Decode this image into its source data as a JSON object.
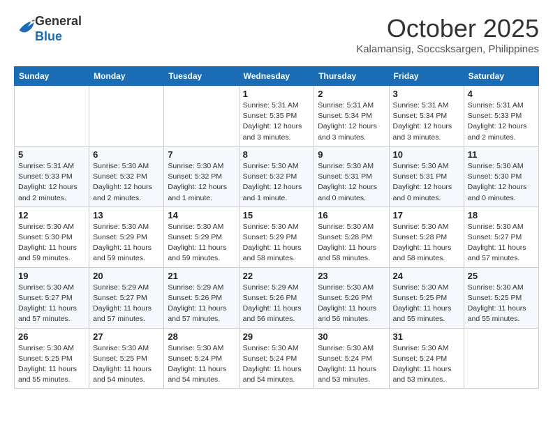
{
  "logo": {
    "general": "General",
    "blue": "Blue"
  },
  "title": "October 2025",
  "subtitle": "Kalamansig, Soccsksargen, Philippines",
  "days_of_week": [
    "Sunday",
    "Monday",
    "Tuesday",
    "Wednesday",
    "Thursday",
    "Friday",
    "Saturday"
  ],
  "weeks": [
    [
      {
        "day": "",
        "sunrise": "",
        "sunset": "",
        "daylight": ""
      },
      {
        "day": "",
        "sunrise": "",
        "sunset": "",
        "daylight": ""
      },
      {
        "day": "",
        "sunrise": "",
        "sunset": "",
        "daylight": ""
      },
      {
        "day": "1",
        "sunrise": "Sunrise: 5:31 AM",
        "sunset": "Sunset: 5:35 PM",
        "daylight": "Daylight: 12 hours and 3 minutes."
      },
      {
        "day": "2",
        "sunrise": "Sunrise: 5:31 AM",
        "sunset": "Sunset: 5:34 PM",
        "daylight": "Daylight: 12 hours and 3 minutes."
      },
      {
        "day": "3",
        "sunrise": "Sunrise: 5:31 AM",
        "sunset": "Sunset: 5:34 PM",
        "daylight": "Daylight: 12 hours and 3 minutes."
      },
      {
        "day": "4",
        "sunrise": "Sunrise: 5:31 AM",
        "sunset": "Sunset: 5:33 PM",
        "daylight": "Daylight: 12 hours and 2 minutes."
      }
    ],
    [
      {
        "day": "5",
        "sunrise": "Sunrise: 5:31 AM",
        "sunset": "Sunset: 5:33 PM",
        "daylight": "Daylight: 12 hours and 2 minutes."
      },
      {
        "day": "6",
        "sunrise": "Sunrise: 5:30 AM",
        "sunset": "Sunset: 5:32 PM",
        "daylight": "Daylight: 12 hours and 2 minutes."
      },
      {
        "day": "7",
        "sunrise": "Sunrise: 5:30 AM",
        "sunset": "Sunset: 5:32 PM",
        "daylight": "Daylight: 12 hours and 1 minute."
      },
      {
        "day": "8",
        "sunrise": "Sunrise: 5:30 AM",
        "sunset": "Sunset: 5:32 PM",
        "daylight": "Daylight: 12 hours and 1 minute."
      },
      {
        "day": "9",
        "sunrise": "Sunrise: 5:30 AM",
        "sunset": "Sunset: 5:31 PM",
        "daylight": "Daylight: 12 hours and 0 minutes."
      },
      {
        "day": "10",
        "sunrise": "Sunrise: 5:30 AM",
        "sunset": "Sunset: 5:31 PM",
        "daylight": "Daylight: 12 hours and 0 minutes."
      },
      {
        "day": "11",
        "sunrise": "Sunrise: 5:30 AM",
        "sunset": "Sunset: 5:30 PM",
        "daylight": "Daylight: 12 hours and 0 minutes."
      }
    ],
    [
      {
        "day": "12",
        "sunrise": "Sunrise: 5:30 AM",
        "sunset": "Sunset: 5:30 PM",
        "daylight": "Daylight: 11 hours and 59 minutes."
      },
      {
        "day": "13",
        "sunrise": "Sunrise: 5:30 AM",
        "sunset": "Sunset: 5:29 PM",
        "daylight": "Daylight: 11 hours and 59 minutes."
      },
      {
        "day": "14",
        "sunrise": "Sunrise: 5:30 AM",
        "sunset": "Sunset: 5:29 PM",
        "daylight": "Daylight: 11 hours and 59 minutes."
      },
      {
        "day": "15",
        "sunrise": "Sunrise: 5:30 AM",
        "sunset": "Sunset: 5:29 PM",
        "daylight": "Daylight: 11 hours and 58 minutes."
      },
      {
        "day": "16",
        "sunrise": "Sunrise: 5:30 AM",
        "sunset": "Sunset: 5:28 PM",
        "daylight": "Daylight: 11 hours and 58 minutes."
      },
      {
        "day": "17",
        "sunrise": "Sunrise: 5:30 AM",
        "sunset": "Sunset: 5:28 PM",
        "daylight": "Daylight: 11 hours and 58 minutes."
      },
      {
        "day": "18",
        "sunrise": "Sunrise: 5:30 AM",
        "sunset": "Sunset: 5:27 PM",
        "daylight": "Daylight: 11 hours and 57 minutes."
      }
    ],
    [
      {
        "day": "19",
        "sunrise": "Sunrise: 5:30 AM",
        "sunset": "Sunset: 5:27 PM",
        "daylight": "Daylight: 11 hours and 57 minutes."
      },
      {
        "day": "20",
        "sunrise": "Sunrise: 5:29 AM",
        "sunset": "Sunset: 5:27 PM",
        "daylight": "Daylight: 11 hours and 57 minutes."
      },
      {
        "day": "21",
        "sunrise": "Sunrise: 5:29 AM",
        "sunset": "Sunset: 5:26 PM",
        "daylight": "Daylight: 11 hours and 57 minutes."
      },
      {
        "day": "22",
        "sunrise": "Sunrise: 5:29 AM",
        "sunset": "Sunset: 5:26 PM",
        "daylight": "Daylight: 11 hours and 56 minutes."
      },
      {
        "day": "23",
        "sunrise": "Sunrise: 5:30 AM",
        "sunset": "Sunset: 5:26 PM",
        "daylight": "Daylight: 11 hours and 56 minutes."
      },
      {
        "day": "24",
        "sunrise": "Sunrise: 5:30 AM",
        "sunset": "Sunset: 5:25 PM",
        "daylight": "Daylight: 11 hours and 55 minutes."
      },
      {
        "day": "25",
        "sunrise": "Sunrise: 5:30 AM",
        "sunset": "Sunset: 5:25 PM",
        "daylight": "Daylight: 11 hours and 55 minutes."
      }
    ],
    [
      {
        "day": "26",
        "sunrise": "Sunrise: 5:30 AM",
        "sunset": "Sunset: 5:25 PM",
        "daylight": "Daylight: 11 hours and 55 minutes."
      },
      {
        "day": "27",
        "sunrise": "Sunrise: 5:30 AM",
        "sunset": "Sunset: 5:25 PM",
        "daylight": "Daylight: 11 hours and 54 minutes."
      },
      {
        "day": "28",
        "sunrise": "Sunrise: 5:30 AM",
        "sunset": "Sunset: 5:24 PM",
        "daylight": "Daylight: 11 hours and 54 minutes."
      },
      {
        "day": "29",
        "sunrise": "Sunrise: 5:30 AM",
        "sunset": "Sunset: 5:24 PM",
        "daylight": "Daylight: 11 hours and 54 minutes."
      },
      {
        "day": "30",
        "sunrise": "Sunrise: 5:30 AM",
        "sunset": "Sunset: 5:24 PM",
        "daylight": "Daylight: 11 hours and 53 minutes."
      },
      {
        "day": "31",
        "sunrise": "Sunrise: 5:30 AM",
        "sunset": "Sunset: 5:24 PM",
        "daylight": "Daylight: 11 hours and 53 minutes."
      },
      {
        "day": "",
        "sunrise": "",
        "sunset": "",
        "daylight": ""
      }
    ]
  ]
}
